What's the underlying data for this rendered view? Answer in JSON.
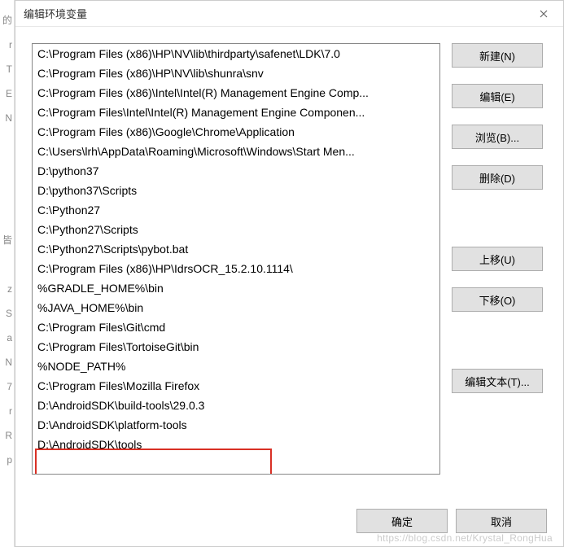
{
  "window": {
    "title": "编辑环境变量"
  },
  "paths": [
    "C:\\Program Files (x86)\\HP\\NV\\lib\\thirdparty\\safenet\\LDK\\7.0",
    "C:\\Program Files (x86)\\HP\\NV\\lib\\shunra\\snv",
    "C:\\Program Files (x86)\\Intel\\Intel(R) Management Engine Comp...",
    "C:\\Program Files\\Intel\\Intel(R) Management Engine Componen...",
    "C:\\Program Files (x86)\\Google\\Chrome\\Application",
    "C:\\Users\\lrh\\AppData\\Roaming\\Microsoft\\Windows\\Start Men...",
    "D:\\python37",
    "D:\\python37\\Scripts",
    "C:\\Python27",
    "C:\\Python27\\Scripts",
    "C:\\Python27\\Scripts\\pybot.bat",
    "C:\\Program Files (x86)\\HP\\IdrsOCR_15.2.10.1114\\",
    "%GRADLE_HOME%\\bin",
    "%JAVA_HOME%\\bin",
    "C:\\Program Files\\Git\\cmd",
    "C:\\Program Files\\TortoiseGit\\bin",
    "%NODE_PATH%",
    "C:\\Program Files\\Mozilla Firefox",
    "D:\\AndroidSDK\\build-tools\\29.0.3",
    "D:\\AndroidSDK\\platform-tools",
    "D:\\AndroidSDK\\tools"
  ],
  "buttons": {
    "new": "新建(N)",
    "edit": "编辑(E)",
    "browse": "浏览(B)...",
    "delete": "删除(D)",
    "move_up": "上移(U)",
    "move_down": "下移(O)",
    "edit_text": "编辑文本(T)...",
    "ok": "确定",
    "cancel": "取消"
  },
  "left_edge_chars": [
    "的",
    "r",
    "T",
    "E",
    "N",
    "",
    "",
    "",
    "",
    "皆",
    "",
    "z",
    "S",
    "a",
    "N",
    "7",
    "r",
    "R",
    "p"
  ],
  "watermark": "https://blog.csdn.net/Krystal_RongHua"
}
